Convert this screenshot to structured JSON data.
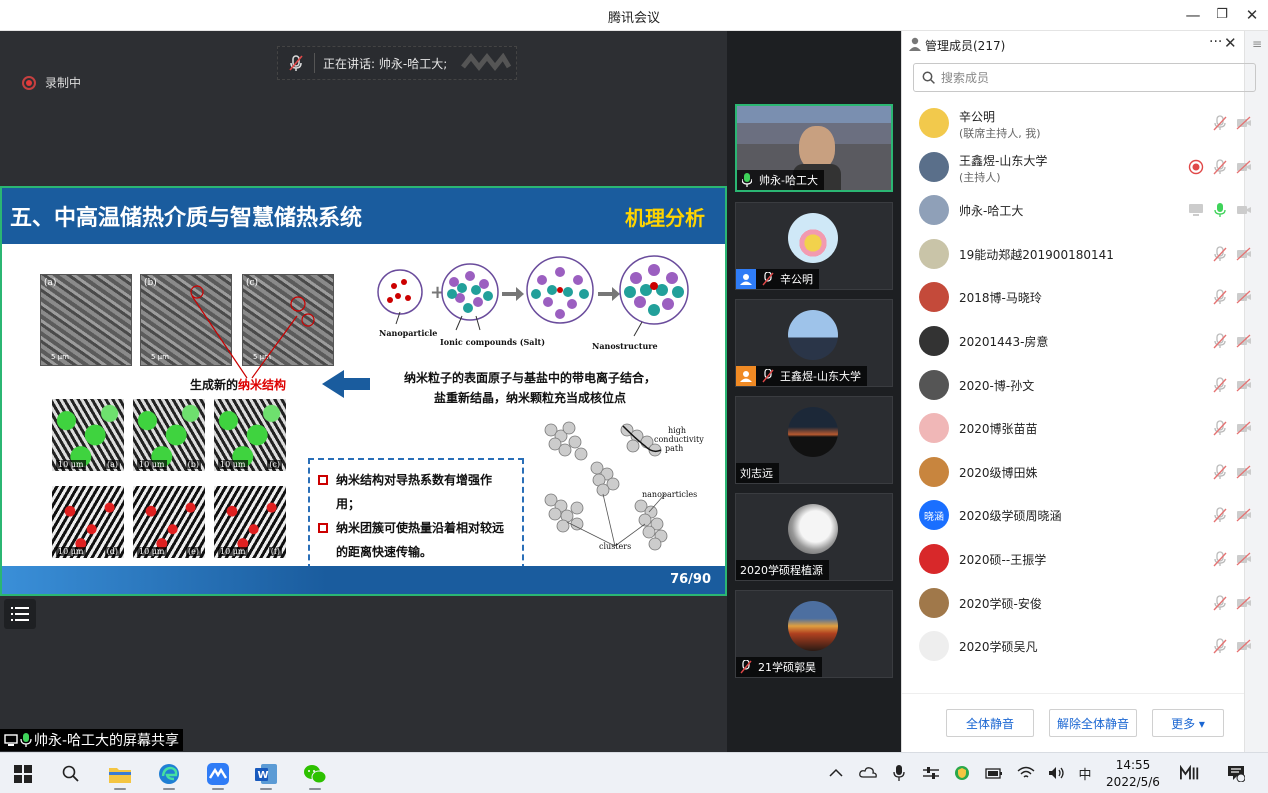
{
  "window": {
    "title": "腾讯会议",
    "minimize": "—",
    "restore": "❐",
    "close": "✕"
  },
  "stage": {
    "speaking_label": "正在讲话: 帅永-哈工大;",
    "recording_label": "录制中",
    "share_label": "帅永-哈工大的屏幕共享"
  },
  "slide": {
    "title": "五、中高温储热介质与智慧储热系统",
    "tag": "机理分析",
    "page": "76/90",
    "sem_labels": [
      "(a)",
      "(b)",
      "(c)"
    ],
    "sem_scale": "5 μm",
    "green_labels": [
      "(a)",
      "(b)",
      "(c)"
    ],
    "red_labels": [
      "(d)",
      "(e)",
      "(f)"
    ],
    "micro_scale": "10 μm",
    "new_structure_prefix": "生成新的",
    "new_structure_highlight": "纳米结构",
    "diagram_nanoparticle": "Nanoparticle",
    "diagram_ionic": "Ionic compounds (Salt)",
    "diagram_nanostructure": "Nanostructure",
    "mechanism_line1": "纳米粒子的表面原子与基盐中的带电离子结合，",
    "mechanism_line2": "盐重新结晶，纳米颗粒充当成核位点",
    "point1": "纳米结构对导热系数有增强作用；",
    "point2": "纳米团簇可使热量沿着相对较远的距离快速传输。",
    "cluster_high": "high",
    "cluster_conductivity": "conductivity",
    "cluster_path": "path",
    "cluster_nanoparticles": "nanoparticles",
    "cluster_clusters": "clusters"
  },
  "video_tiles": [
    {
      "name": "帅永-哈工大"
    },
    {
      "name": "辛公明"
    },
    {
      "name": "王鑫煜-山东大学"
    },
    {
      "name": "刘志远"
    },
    {
      "name": "2020学硕程植源"
    },
    {
      "name": "21学硕郭昊"
    }
  ],
  "panel": {
    "title": "管理成员(217)",
    "more": "···",
    "close": "✕",
    "search_placeholder": "搜索成员",
    "members": [
      {
        "name": "辛公明",
        "role": "(联席主持人, 我)",
        "color": "#f2c94c"
      },
      {
        "name": "王鑫煜-山东大学",
        "role": "(主持人)",
        "color": "#5a6f8a"
      },
      {
        "name": "帅永-哈工大",
        "role": "",
        "color": "#8fa0b8"
      },
      {
        "name": "19能动郑越201900180141",
        "role": "",
        "color": "#c9c4a8"
      },
      {
        "name": "2018博-马晓玲",
        "role": "",
        "color": "#c44a3a"
      },
      {
        "name": "20201443-房意",
        "role": "",
        "color": "#333333"
      },
      {
        "name": "2020-博-孙文",
        "role": "",
        "color": "#555555"
      },
      {
        "name": "2020博张苗苗",
        "role": "",
        "color": "#f0b7b7"
      },
      {
        "name": "2020级博田姝",
        "role": "",
        "color": "#c8853e"
      },
      {
        "name": "2020级学硕周晓涵",
        "role": "",
        "avatar_text": "晓涵",
        "color": "#1a6fff"
      },
      {
        "name": "2020硕--王振学",
        "role": "",
        "color": "#d8282a"
      },
      {
        "name": "2020学硕-安俊",
        "role": "",
        "color": "#a0784a"
      },
      {
        "name": "2020学硕吴凡",
        "role": "",
        "color": "#eeeeee"
      }
    ],
    "mute_all": "全体静音",
    "unmute_all": "解除全体静音",
    "more_btn": "更多 ▾"
  },
  "taskbar": {
    "time": "14:55",
    "date": "2022/5/6",
    "ime": "中"
  }
}
